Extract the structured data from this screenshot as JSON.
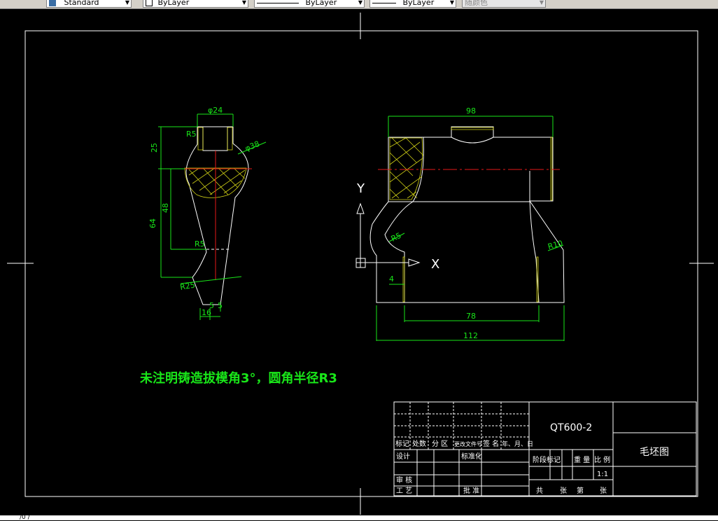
{
  "toolbar": {
    "textstyle": "Standard",
    "layer": "ByLayer",
    "linetype": "ByLayer",
    "lineweight": "ByLayer",
    "plotstyle": "随颜色"
  },
  "colors": {
    "dim": "#19e619",
    "outline": "#ffffff",
    "center": "#e61919",
    "hatch": "#e6e619",
    "background": "#000000"
  },
  "drawing": {
    "note": "未注明铸造拔模角3°，圆角半径R3",
    "left_view": {
      "dims": [
        "φ24",
        "R5",
        "25",
        "φ38",
        "48",
        "64",
        "R5",
        "R25",
        "16",
        "5",
        "5"
      ]
    },
    "front_view": {
      "dims": [
        "98",
        "R5",
        "R10",
        "4",
        "78",
        "112"
      ],
      "axis_y": "Y",
      "axis_x": "X"
    }
  },
  "title_block": {
    "material": "QT600-2",
    "drawing_name": "毛坯图",
    "headers": [
      "标记",
      "处数",
      "分 区",
      "更改文件号",
      "签 名",
      "年、月、日"
    ],
    "design": "设计",
    "standardize": "标准化",
    "review": "审 核",
    "process": "工 艺",
    "approve": "批 准",
    "stage_mark": "阶段标记",
    "weight": "重 量",
    "scale_label": "比 例",
    "scale": "1:1",
    "total": "共",
    "sheets": "张",
    "page": "第",
    "sheet": "张"
  },
  "status": {
    "text": "/0 /"
  }
}
